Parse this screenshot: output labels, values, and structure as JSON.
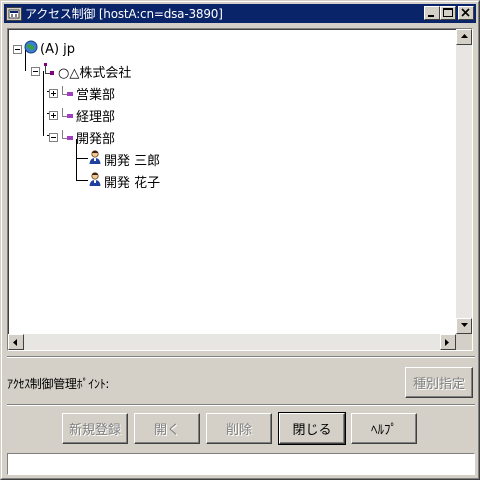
{
  "window": {
    "title": "アクセス制御 [hostA:cn=dsa-3890]"
  },
  "tree": {
    "root": {
      "label": "(A) jp",
      "icon": "globe-icon"
    },
    "org": {
      "label": "○△株式会社",
      "icon": "organization-icon"
    },
    "units": [
      {
        "label": "営業部",
        "icon": "org-unit-icon",
        "expanded": false
      },
      {
        "label": "経理部",
        "icon": "org-unit-icon",
        "expanded": false
      },
      {
        "label": "開発部",
        "icon": "org-unit-icon",
        "expanded": true
      }
    ],
    "persons": [
      {
        "label": "開発 三郎",
        "icon": "person-icon"
      },
      {
        "label": "開発 花子",
        "icon": "person-icon"
      }
    ]
  },
  "access_point": {
    "label": "ｱｸｾｽ制御管理ﾎﾟｲﾝﾄ:",
    "type_button": "種別指定"
  },
  "buttons": {
    "new": "新規登録",
    "open": "開く",
    "delete": "削除",
    "close": "閉じる",
    "help": "ﾍﾙﾌﾟ"
  },
  "status": {
    "message": ""
  },
  "colors": {
    "titlebar": "#0a246a",
    "face": "#d4d0c8",
    "disabled_text": "#808080"
  }
}
